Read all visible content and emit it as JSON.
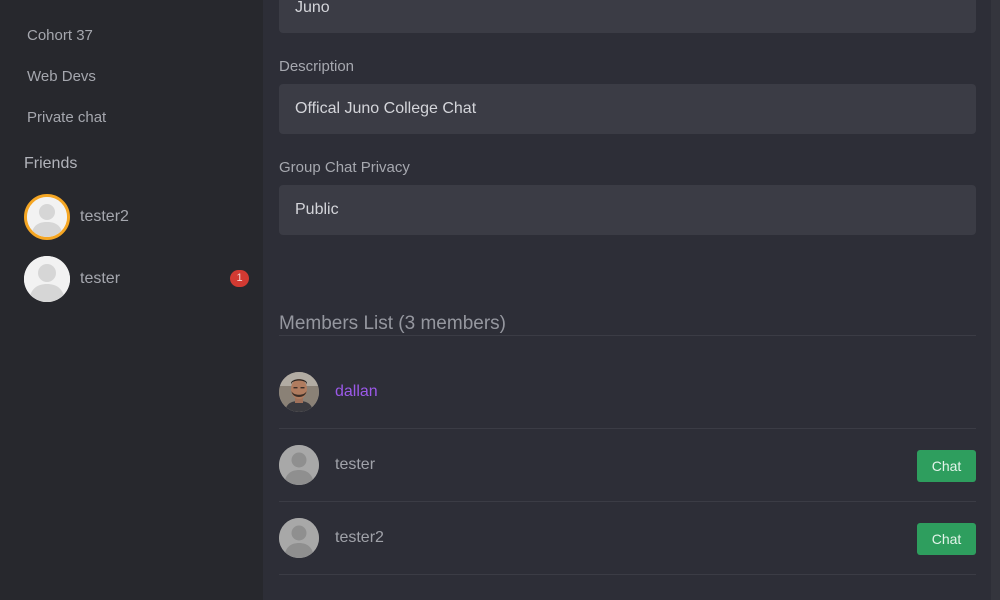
{
  "sidebar": {
    "channels": [
      {
        "label": "Cohort 37"
      },
      {
        "label": "Web Devs"
      },
      {
        "label": "Private chat"
      }
    ],
    "friends_heading": "Friends",
    "friends": [
      {
        "name": "tester2",
        "status": "online"
      },
      {
        "name": "tester",
        "unread": "1"
      }
    ]
  },
  "form": {
    "name_value": "Juno",
    "description_label": "Description",
    "description_value": "Offical Juno College Chat",
    "privacy_label": "Group Chat Privacy",
    "privacy_value": "Public"
  },
  "members": {
    "title": "Members List (3 members)",
    "list": [
      {
        "name": "dallan",
        "avatar": "user-photo-avatar"
      },
      {
        "name": "tester",
        "avatar": "default-avatar-icon",
        "action": "Chat"
      },
      {
        "name": "tester2",
        "avatar": "default-avatar-icon",
        "action": "Chat"
      }
    ]
  },
  "colors": {
    "background": "#2d2e37",
    "sidebar": "#27282d",
    "input": "#3b3c45",
    "online_ring": "#f5a623",
    "unread_badge": "#d23a32",
    "self_name": "#9b59e8",
    "chat_button": "#2e9e5e"
  }
}
